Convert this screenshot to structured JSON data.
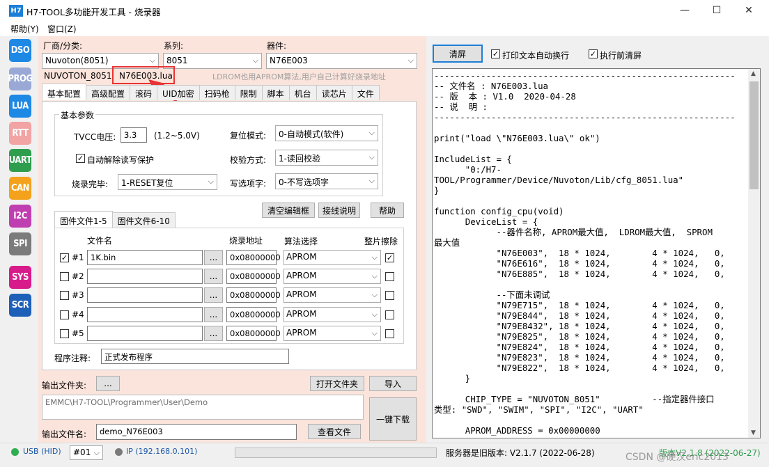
{
  "window": {
    "icon_text": "H7",
    "title": "H7-TOOL多功能开发工具 - 烧录器",
    "min": "—",
    "max": "☐",
    "close": "✕"
  },
  "menu": [
    "帮助(Y)",
    "窗口(Z)"
  ],
  "sidebar": [
    {
      "label": "DSO",
      "color": "#1e88e5"
    },
    {
      "label": "PROG",
      "color": "#9aa8d6"
    },
    {
      "label": "LUA",
      "color": "#1e88e5"
    },
    {
      "label": "RTT",
      "color": "#f2a3a3"
    },
    {
      "label": "UART",
      "color": "#2e9e4e"
    },
    {
      "label": "CAN",
      "color": "#f4a21b"
    },
    {
      "label": "I2C",
      "color": "#c03fb0"
    },
    {
      "label": "SPI",
      "color": "#7b7b7b"
    },
    {
      "label": "SYS",
      "color": "#d81b8a"
    },
    {
      "label": "SCR",
      "color": "#1e5fb8"
    }
  ],
  "device": {
    "vendor_label": "厂商/分类:",
    "vendor_value": "Nuvoton(8051)",
    "series_label": "系列:",
    "series_value": "8051",
    "chip_label": "器件:",
    "chip_value": "N76E003",
    "vendor_folder": "NUVOTON_8051",
    "lua_file": "N76E003.lua",
    "note": "LDROM也用APROM算法,用户自己计算好烧录地址"
  },
  "tabs": [
    "基本配置",
    "高级配置",
    "滚码",
    "UID加密",
    "扫码枪",
    "限制",
    "脚本",
    "机台",
    "读芯片",
    "文件"
  ],
  "basic": {
    "group_title": "基本参数",
    "tvcc_label": "TVCC电压:",
    "tvcc_value": "3.3",
    "tvcc_range": "(1.2~5.0V)",
    "auto_unlock_label": "自动解除读写保护",
    "after_label": "烧录完毕:",
    "after_value": "1-RESET复位",
    "reset_label": "复位模式:",
    "reset_value": "0-自动模式(软件)",
    "verify_label": "校验方式:",
    "verify_value": "1-读回校验",
    "option_label": "写选项字:",
    "option_value": "0-不写选项字"
  },
  "buttons": {
    "clear_edit": "清空编辑框",
    "wiring": "接线说明",
    "help": "帮助",
    "output_folder_browse": "...",
    "open_folder": "打开文件夹",
    "import": "导入",
    "view_file": "查看文件",
    "one_key": "一键下载",
    "clear_screen": "清屏"
  },
  "file_tabs": [
    "固件文件1-5",
    "固件文件6-10"
  ],
  "file_table": {
    "headers": {
      "filename": "文件名",
      "address": "烧录地址",
      "algo": "算法选择",
      "erase": "整片擦除"
    },
    "rows": [
      {
        "num": "#1",
        "checked": "✓",
        "file": "1K.bin",
        "browse": "...",
        "address": "0x08000000",
        "algo": "APROM",
        "erase": "✓"
      },
      {
        "num": "#2",
        "checked": "",
        "file": "",
        "browse": "...",
        "address": "0x08000000",
        "algo": "APROM",
        "erase": ""
      },
      {
        "num": "#3",
        "checked": "",
        "file": "",
        "browse": "...",
        "address": "0x08000000",
        "algo": "APROM",
        "erase": ""
      },
      {
        "num": "#4",
        "checked": "",
        "file": "",
        "browse": "...",
        "address": "0x08000000",
        "algo": "APROM",
        "erase": ""
      },
      {
        "num": "#5",
        "checked": "",
        "file": "",
        "browse": "...",
        "address": "0x08000000",
        "algo": "APROM",
        "erase": ""
      }
    ]
  },
  "comment": {
    "label": "程序注释:",
    "value": "正式发布程序"
  },
  "output": {
    "folder_label": "输出文件夹:",
    "folder_path": "EMMC\\H7-TOOL\\Programmer\\User\\Demo",
    "name_label": "输出文件名:",
    "name_value": "demo_N76E003"
  },
  "console": {
    "auto_wrap_label": "打印文本自动换行",
    "clear_before_label": "执行前清屏",
    "text": "----------------------------------------------------------\n-- 文件名 : N76E003.lua\n-- 版  本 : V1.0  2020-04-28\n-- 说  明 :\n----------------------------------------------------------\n\nprint(\"load \\\"N76E003.lua\\\" ok\")\n\nIncludeList = {\n      \"0:/H7-\nTOOL/Programmer/Device/Nuvoton/Lib/cfg_8051.lua\"\n}\n\nfunction config_cpu(void)\n      DeviceList = {\n            --器件名称, APROM最大值,  LDROM最大值,  SPROM\n最大值\n            \"N76E003\",  18 * 1024,        4 * 1024,   0,\n            \"N76E616\",  18 * 1024,        4 * 1024,   0,\n            \"N76E885\",  18 * 1024,        4 * 1024,   0,\n\n            --下面未调试\n            \"N79E715\",  18 * 1024,        4 * 1024,   0,\n            \"N79E844\",  18 * 1024,        4 * 1024,   0,\n            \"N79E8432\", 18 * 1024,        4 * 1024,   0,\n            \"N79E825\",  18 * 1024,        4 * 1024,   0,\n            \"N79E824\",  18 * 1024,        4 * 1024,   0,\n            \"N79E823\",  18 * 1024,        4 * 1024,   0,\n            \"N79E822\",  18 * 1024,        4 * 1024,   0,\n      }\n\n      CHIP_TYPE = \"NUVOTON_8051\"          --指定器件接口\n类型: \"SWD\", \"SWIM\", \"SPI\", \"I2C\", \"UART\"\n\n      APROM_ADDRESS = 0x00000000"
  },
  "status": {
    "usb": "USB (HID)",
    "device_no": "#01",
    "ip": "IP (192.168.0.101)",
    "server_version": "服务器是旧版本: V2.1.7 (2022-06-28)",
    "current_version": "版本V2.1.8 (2022-06-27)",
    "watermark": "CSDN @硬汉eric2013"
  },
  "colors": {
    "highlight": "#e83434",
    "accent": "#1c7fd6"
  }
}
